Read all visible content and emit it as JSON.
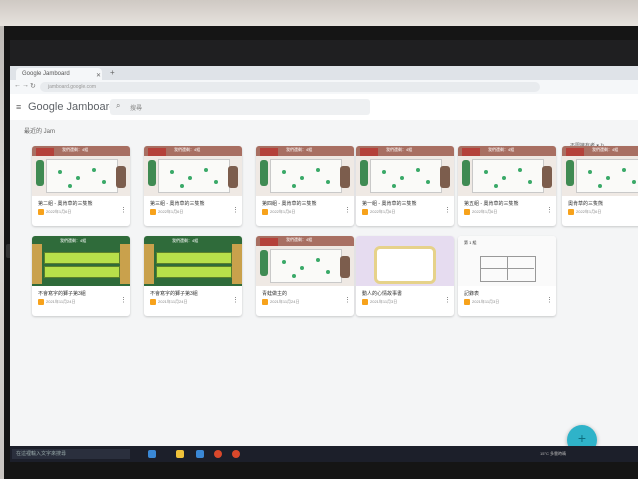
{
  "browser": {
    "tab_title": "Google Jamboard",
    "url": "jamboard.google.com"
  },
  "app": {
    "brand": "Google Jamboard",
    "search_placeholder": "搜尋",
    "section_label": "最近的 Jam",
    "sort_label": "不限擁有者"
  },
  "cards": [
    {
      "title": "第二組 - 奧肯草的三隻熊",
      "date": "2022年1月6日",
      "thumb": "cactus",
      "header": "我們還剩：4組"
    },
    {
      "title": "第三組 - 奧肯草的三隻熊",
      "date": "2022年1月6日",
      "thumb": "cactus",
      "header": "我們還剩：4組"
    },
    {
      "title": "第四組 - 奧肯草的三隻熊",
      "date": "2022年1月6日",
      "thumb": "cactus",
      "header": "我們還剩：4組"
    },
    {
      "title": "第一組 - 奧肯草的三隻熊",
      "date": "2022年1月6日",
      "thumb": "cactus",
      "header": "我們還剩：4組"
    },
    {
      "title": "第五組 - 奧肯草的三隻熊",
      "date": "2022年1月6日",
      "thumb": "cactus",
      "header": "我們還剩：4組"
    },
    {
      "title": "奧肯草的三隻熊",
      "date": "2022年1月6日",
      "thumb": "cactus",
      "header": "我們還剩：4組"
    },
    {
      "title": "不會寫字的獅子第3組",
      "date": "2021年11月24日",
      "thumb": "green",
      "header": "我們還剩：4組"
    },
    {
      "title": "不會寫字的獅子第3組",
      "date": "2021年11月24日",
      "thumb": "green",
      "header": "我們還剩：4組"
    },
    {
      "title": "青蛙做主的",
      "date": "2021年11月24日",
      "thumb": "cactus",
      "header": "我們還剩：4組"
    },
    {
      "title": "動人的心情故事書",
      "date": "2021年11月3日",
      "thumb": "purple",
      "header": ""
    },
    {
      "title": "記錄表",
      "date": "2021年11月3日",
      "thumb": "grid",
      "header": "第 1 組"
    }
  ],
  "taskbar": {
    "search_placeholder": "在這裡輸入文字來搜尋",
    "tray": "15°C 多雲時晴"
  },
  "colors": {
    "accent": "#2fb3c9",
    "card_header": "#a86f62",
    "jam_icon": "#f7a21b"
  }
}
